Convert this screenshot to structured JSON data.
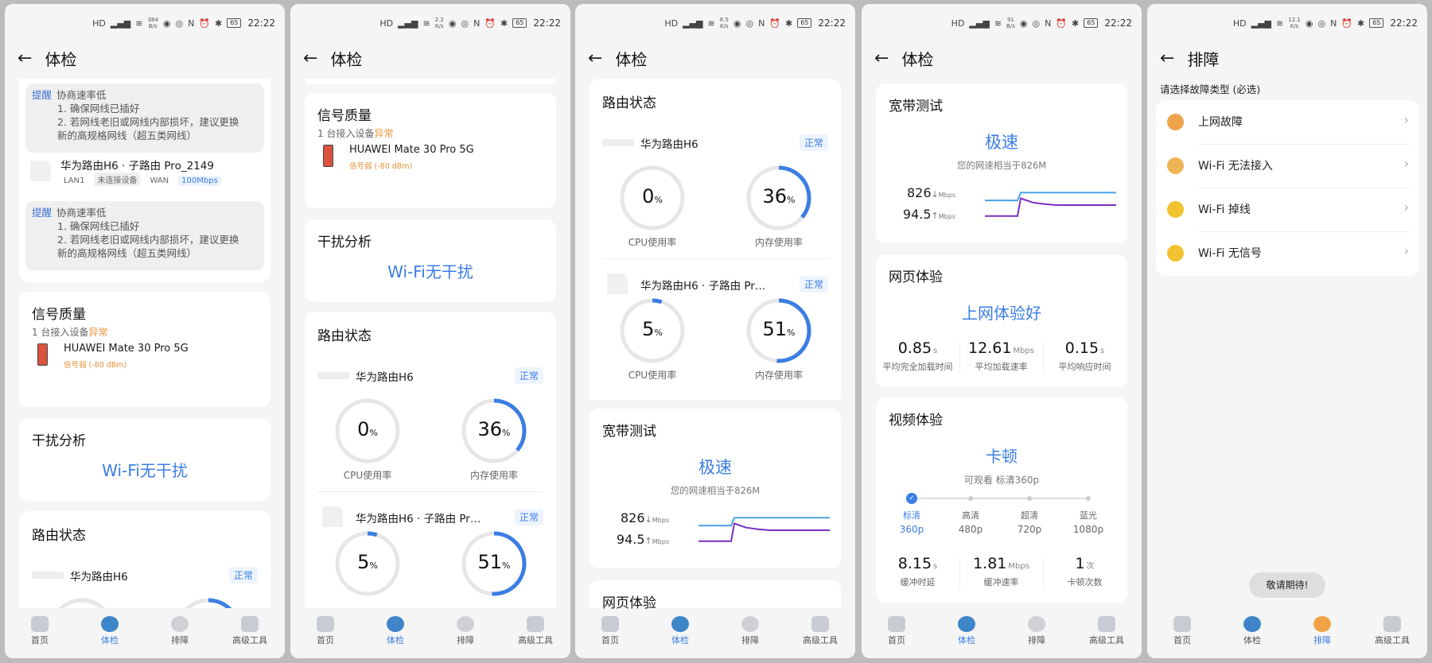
{
  "status_bar": {
    "time": "22:22",
    "battery": "65",
    "network": "4G"
  },
  "screens": [
    {
      "title": "体检",
      "net_speed": "384",
      "net_unit": "B/s"
    },
    {
      "title": "体检",
      "net_speed": "2.2",
      "net_unit": "K/s"
    },
    {
      "title": "体检",
      "net_speed": "8.5",
      "net_unit": "K/s"
    },
    {
      "title": "体检",
      "net_speed": "91",
      "net_unit": "B/s"
    },
    {
      "title": "排障",
      "net_speed": "12.1",
      "net_unit": "K/s"
    }
  ],
  "nav": {
    "items": [
      {
        "label": "首页"
      },
      {
        "label": "体检"
      },
      {
        "label": "排障"
      },
      {
        "label": "高级工具"
      }
    ]
  },
  "port_check": {
    "reminder": {
      "tag": "提醒",
      "title": "协商速率低",
      "line1": "1. 确保网线已插好",
      "line2": "2. 若网线老旧或网线内部损坏，建议更换",
      "line3": "新的高规格网线（超五类网线）"
    },
    "device": {
      "name": "华为路由H6 · 子路由 Pro_2149",
      "lan_label": "LAN1",
      "lan_value": "未连接设备",
      "wan_label": "WAN",
      "wan_value": "100Mbps"
    }
  },
  "signal": {
    "title": "信号质量",
    "summary_prefix": "1 台接入设备",
    "summary_status": "异常",
    "device": "HUAWEI Mate 30 Pro 5G",
    "device_signal": "信号弱 (-80 dBm)"
  },
  "interference": {
    "title": "干扰分析",
    "result": "Wi-Fi无干扰"
  },
  "router_status": {
    "title": "路由状态",
    "cpu_label": "CPU使用率",
    "mem_label": "内存使用率",
    "unit": "%",
    "routers": [
      {
        "name": "华为路由H6",
        "status": "正常",
        "cpu": 0,
        "mem": 36
      },
      {
        "name": "华为路由H6 · 子路由 Pr…",
        "status": "正常",
        "cpu": 5,
        "mem": 51
      }
    ]
  },
  "broadband": {
    "title": "宽带测试",
    "result": "极速",
    "subtitle": "您的网速相当于826M",
    "download": "826",
    "download_arrow": "↓",
    "upload": "94.5",
    "upload_arrow": "↑",
    "unit": "Mbps",
    "chart_data": {
      "type": "line",
      "series": [
        {
          "name": "download",
          "color": "#4aa3e8",
          "values": [
            70,
            70,
            70,
            100,
            100,
            100,
            100,
            100,
            100,
            100,
            100,
            100
          ]
        },
        {
          "name": "upload",
          "color": "#7b2fbf",
          "values": [
            10,
            10,
            10,
            78,
            62,
            56,
            52,
            52,
            52,
            52,
            52,
            52
          ]
        }
      ],
      "ylim": [
        0,
        110
      ]
    }
  },
  "web": {
    "title": "网页体验",
    "result": "上网体验好",
    "metrics": [
      {
        "value": "0.85",
        "unit": "s",
        "label": "平均完全加载时间"
      },
      {
        "value": "12.61",
        "unit": "Mbps",
        "label": "平均加载速率"
      },
      {
        "value": "0.15",
        "unit": "s",
        "label": "平均响应时间"
      }
    ]
  },
  "video": {
    "title": "视频体验",
    "result": "卡顿",
    "subtitle": "可观看 标清360p",
    "levels": [
      {
        "name": "标清",
        "res": "360p",
        "selected": true
      },
      {
        "name": "高清",
        "res": "480p",
        "selected": false
      },
      {
        "name": "超清",
        "res": "720p",
        "selected": false
      },
      {
        "name": "蓝光",
        "res": "1080p",
        "selected": false
      }
    ],
    "metrics": [
      {
        "value": "8.15",
        "unit": "s",
        "label": "缓冲时延"
      },
      {
        "value": "1.81",
        "unit": "Mbps",
        "label": "缓冲速率"
      },
      {
        "value": "1",
        "unit": "次",
        "label": "卡顿次数"
      }
    ]
  },
  "troubleshoot": {
    "prompt": "请选择故障类型 (必选)",
    "items": [
      {
        "label": "上网故障",
        "color": "#eea44a"
      },
      {
        "label": "Wi-Fi 无法接入",
        "color": "#f0b455"
      },
      {
        "label": "Wi-Fi 掉线",
        "color": "#f2c230"
      },
      {
        "label": "Wi-Fi 无信号",
        "color": "#f2c230"
      }
    ],
    "toast": "敬请期待!"
  },
  "colors": {
    "accent": "#3b7de3",
    "warning": "#e8913a",
    "ring_track": "#e6e6e6"
  }
}
